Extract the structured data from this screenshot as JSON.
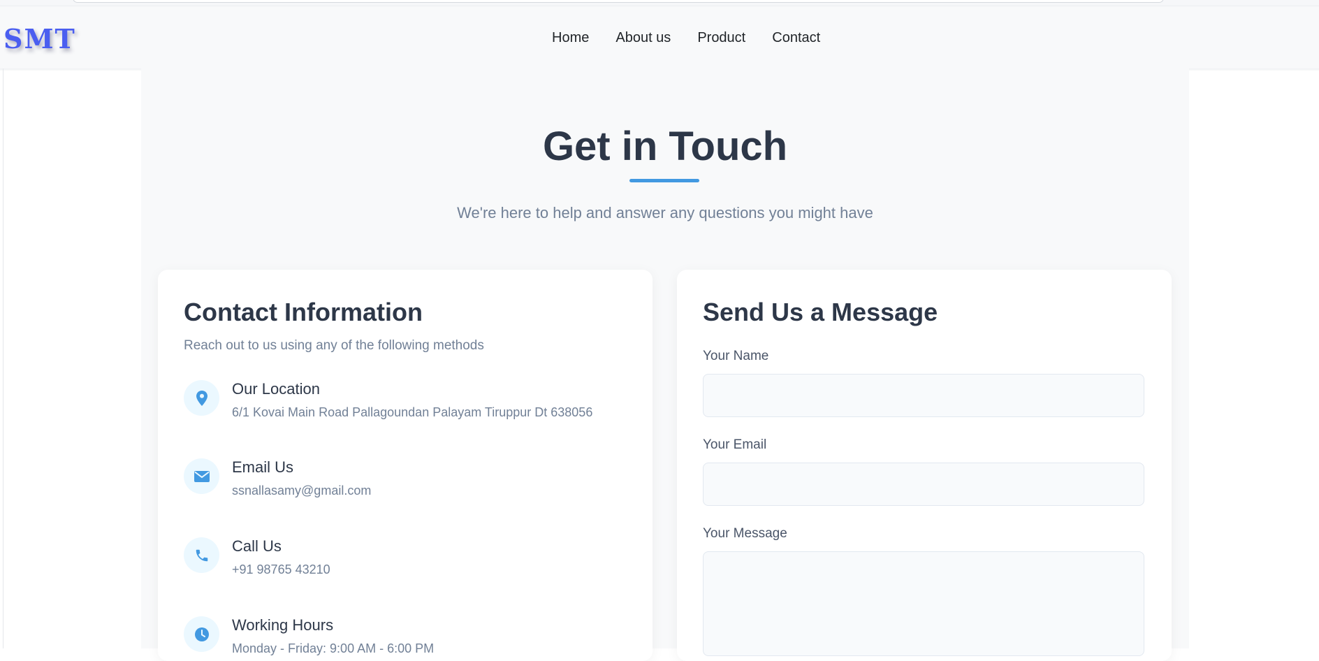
{
  "brand": {
    "logo_text": "SMT",
    "color": "#4a5ef0"
  },
  "nav": {
    "links": [
      "Home",
      "About us",
      "Product",
      "Contact"
    ]
  },
  "hero": {
    "title": "Get in Touch",
    "subtitle": "We're here to help and answer any questions you might have",
    "accent_color": "#4299e1"
  },
  "contact_info": {
    "title": "Contact Information",
    "description": "Reach out to us using any of the following methods",
    "items": [
      {
        "icon": "location-pin-icon",
        "title": "Our Location",
        "text": "6/1 Kovai Main Road Pallagoundan Palayam Tiruppur Dt 638056"
      },
      {
        "icon": "envelope-icon",
        "title": "Email Us",
        "text": "ssnallasamy@gmail.com"
      },
      {
        "icon": "phone-icon",
        "title": "Call Us",
        "text": "+91 98765 43210"
      },
      {
        "icon": "clock-icon",
        "title": "Working Hours",
        "text": "Monday - Friday: 9:00 AM - 6:00 PM"
      }
    ]
  },
  "message_form": {
    "title": "Send Us a Message",
    "name_label": "Your Name",
    "name_value": "",
    "email_label": "Your Email",
    "email_value": "",
    "message_label": "Your Message",
    "message_value": ""
  }
}
